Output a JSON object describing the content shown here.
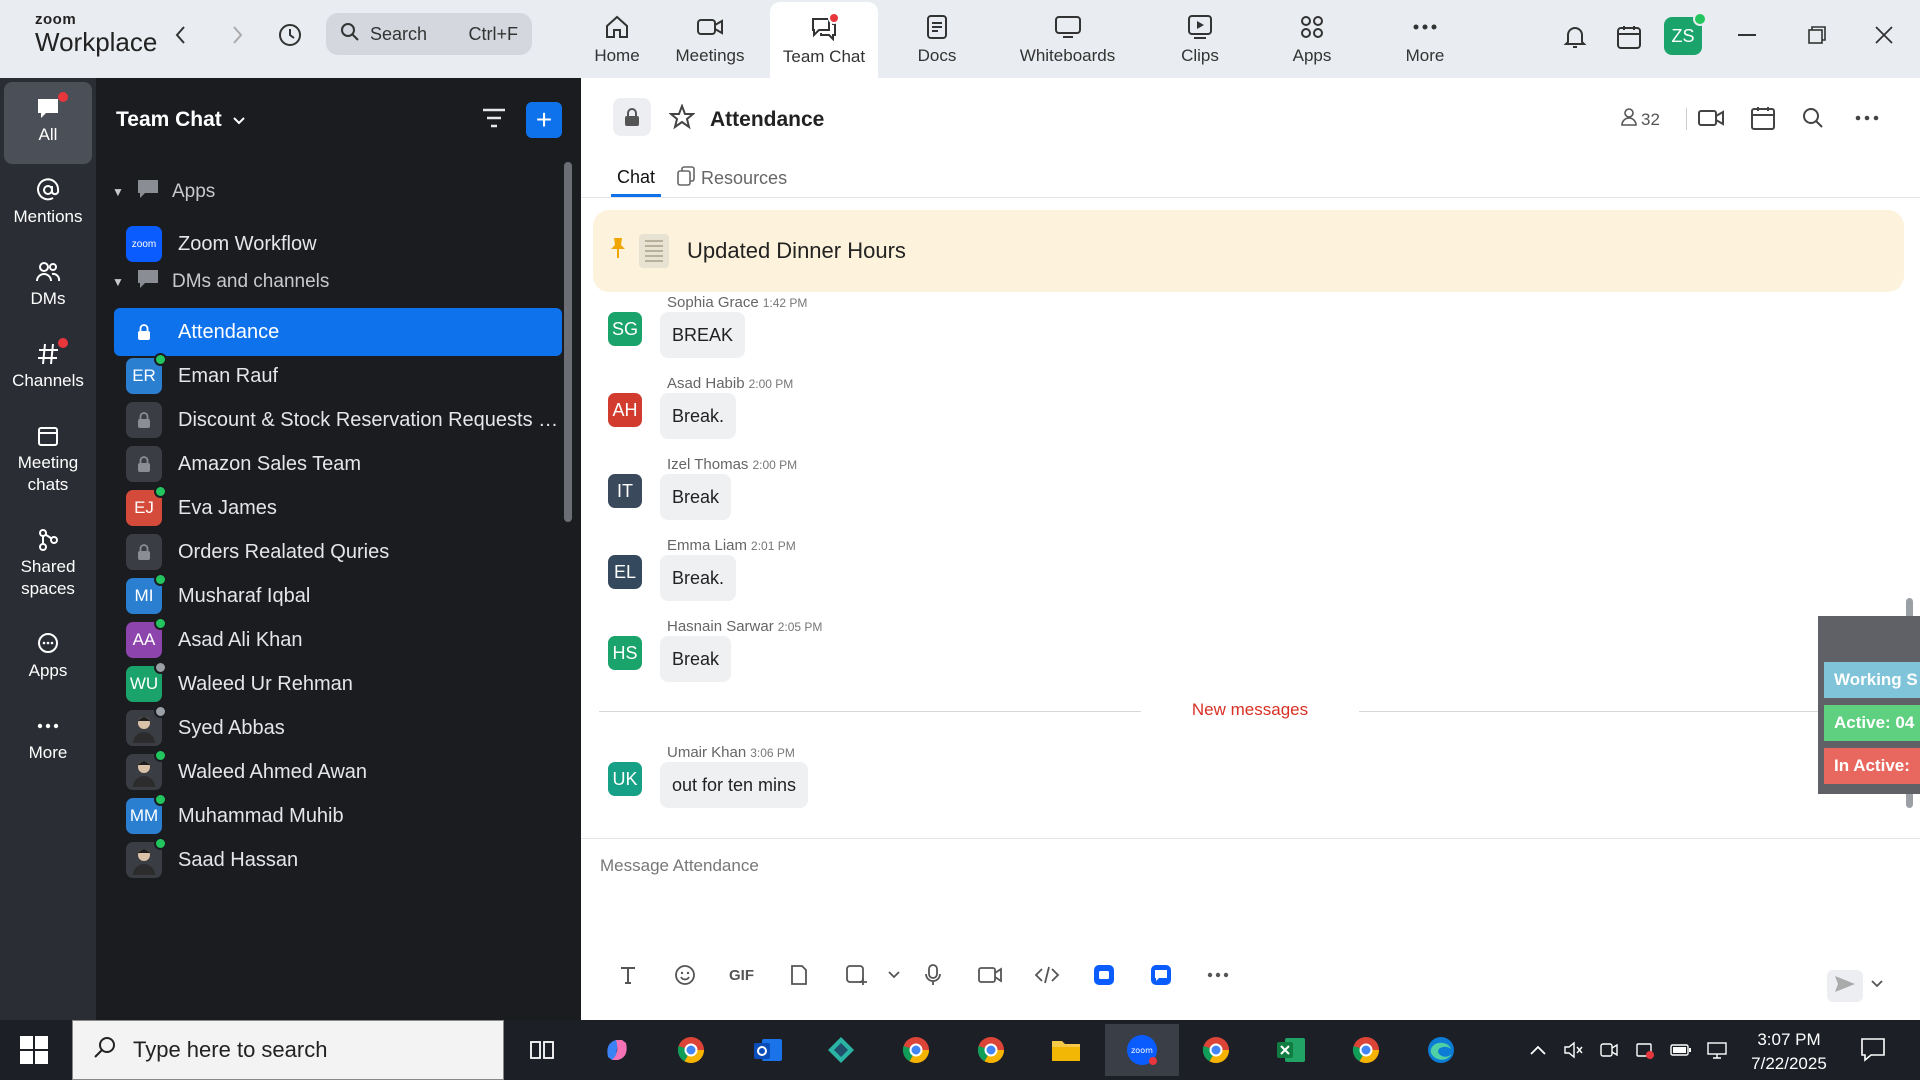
{
  "app": {
    "logo_top": "zoom",
    "logo_bottom": "Workplace"
  },
  "search": {
    "placeholder": "Search",
    "shortcut": "Ctrl+F"
  },
  "nav_tabs": [
    {
      "label": "Home",
      "icon": "home-icon"
    },
    {
      "label": "Meetings",
      "icon": "video-camera-icon"
    },
    {
      "label": "Team Chat",
      "icon": "chat-icon",
      "active": true,
      "badge": true
    },
    {
      "label": "Docs",
      "icon": "document-icon"
    },
    {
      "label": "Whiteboards",
      "icon": "whiteboard-icon"
    },
    {
      "label": "Clips",
      "icon": "clips-icon"
    },
    {
      "label": "Apps",
      "icon": "apps-icon"
    },
    {
      "label": "More",
      "icon": "more-dots-icon"
    }
  ],
  "user": {
    "initials": "ZS",
    "status_color": "#22c55e"
  },
  "rail": [
    {
      "label": "All",
      "active": true,
      "badge": true
    },
    {
      "label": "Mentions"
    },
    {
      "label": "DMs"
    },
    {
      "label": "Channels",
      "badge": true
    },
    {
      "label": "Meeting chats"
    },
    {
      "label": "Shared spaces"
    },
    {
      "label": "Apps"
    },
    {
      "label": "More"
    }
  ],
  "sidebar": {
    "title": "Team Chat",
    "sections": {
      "apps": "Apps",
      "dms": "DMs and channels"
    },
    "app_items": [
      {
        "name": "Zoom Workflow",
        "avatar_text": "zoom"
      }
    ],
    "items": [
      {
        "name": "Attendance",
        "type": "lock",
        "active": true
      },
      {
        "name": "Eman Rauf",
        "initials": "ER",
        "color": "#2b7fd1",
        "status": "online"
      },
      {
        "name": "Discount & Stock Reservation Requests O...",
        "type": "lock"
      },
      {
        "name": "Amazon Sales Team",
        "type": "lock"
      },
      {
        "name": "Eva James",
        "initials": "EJ",
        "color": "#d44b3c",
        "status": "online"
      },
      {
        "name": "Orders Realated Quries",
        "type": "lock"
      },
      {
        "name": "Musharaf Iqbal",
        "initials": "MI",
        "color": "#2b7fd1",
        "status": "online"
      },
      {
        "name": "Asad Ali Khan",
        "initials": "AA",
        "color": "#8e44ad",
        "status": "online"
      },
      {
        "name": "Waleed Ur Rehman",
        "initials": "WU",
        "color": "#1aa36a",
        "status": "away"
      },
      {
        "name": "Syed Abbas",
        "initials": "",
        "color": "#555",
        "status": "away",
        "photo": true
      },
      {
        "name": "Waleed Ahmed Awan",
        "initials": "",
        "color": "#555",
        "status": "online",
        "photo": true
      },
      {
        "name": "Muhammad Muhib",
        "initials": "MM",
        "color": "#2b7fd1",
        "status": "online"
      },
      {
        "name": "Saad Hassan",
        "initials": "",
        "color": "#555",
        "status": "online",
        "photo": true
      }
    ]
  },
  "channel": {
    "title": "Attendance",
    "member_count": "32",
    "tabs": {
      "chat": "Chat",
      "resources": "Resources"
    },
    "pinned": "Updated Dinner Hours",
    "messages": [
      {
        "sender": "Sophia Grace",
        "time": "1:42 PM",
        "initials": "SG",
        "color": "#1aa36a",
        "text": "BREAK"
      },
      {
        "sender": "Asad Habib",
        "time": "2:00 PM",
        "initials": "AH",
        "color": "#d23c2f",
        "text": "Break."
      },
      {
        "sender": "Izel Thomas",
        "time": "2:00 PM",
        "initials": "IT",
        "color": "#3a4a5c",
        "text": "Break"
      },
      {
        "sender": "Emma Liam",
        "time": "2:01 PM",
        "initials": "EL",
        "color": "#34495e",
        "text": "Break."
      },
      {
        "sender": "Hasnain Sarwar",
        "time": "2:05 PM",
        "initials": "HS",
        "color": "#1aa36a",
        "text": "Break"
      }
    ],
    "new_messages_label": "New messages",
    "new_message": {
      "sender": "Umair Khan",
      "time": "3:06 PM",
      "initials": "UK",
      "color": "#16a085",
      "text": "out for ten mins"
    },
    "composer_placeholder": "Message Attendance",
    "gif_label": "GIF"
  },
  "widget": [
    {
      "text": "Working S",
      "color": "#7fc4d8"
    },
    {
      "text": "Active: 04",
      "color": "#5fcf80"
    },
    {
      "text": "In Active:",
      "color": "#e8685f"
    }
  ],
  "taskbar": {
    "search_placeholder": "Type here to search",
    "time": "3:07 PM",
    "date": "7/22/2025"
  }
}
